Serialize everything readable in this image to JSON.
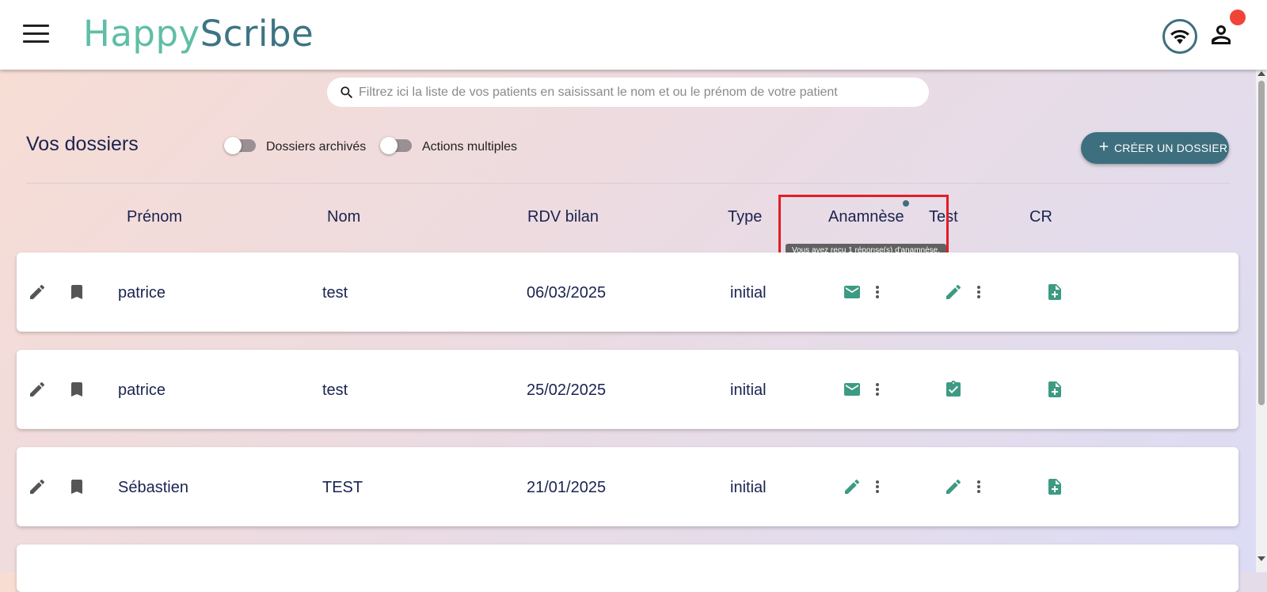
{
  "header": {
    "logo_part1": "Happy",
    "logo_part2": "Scribe",
    "icons": [
      "menu-icon",
      "wifi-icon",
      "user-icon"
    ],
    "notification_color": "#f04438"
  },
  "search": {
    "placeholder": "Filtrez ici la liste de vos patients en saisissant le nom et ou le prénom de votre patient",
    "value": ""
  },
  "toolbar": {
    "title": "Vos dossiers",
    "toggle_archived_label": "Dossiers archivés",
    "toggle_multiple_label": "Actions multiples",
    "create_label": "CRÉER UN DOSSIER"
  },
  "columns": {
    "prenom": "Prénom",
    "nom": "Nom",
    "rdv": "RDV bilan",
    "type": "Type",
    "anamnese": "Anamnèse",
    "test": "Test",
    "cr": "CR"
  },
  "tooltip": "Vous avez reçu 1 réponse(s) d'anamnèse.",
  "rows": [
    {
      "prenom": "patrice",
      "nom": "test",
      "rdv": "06/03/2025",
      "type": "initial",
      "anamnese_icon": "mail-icon",
      "test_icon": "pencil-icon"
    },
    {
      "prenom": "patrice",
      "nom": "test",
      "rdv": "25/02/2025",
      "type": "initial",
      "anamnese_icon": "mail-icon",
      "test_icon": "clipboard-check-icon"
    },
    {
      "prenom": "Sébastien",
      "nom": "TEST",
      "rdv": "21/01/2025",
      "type": "initial",
      "anamnese_icon": "pencil-icon",
      "test_icon": "pencil-icon"
    }
  ],
  "colors": {
    "accent": "#3d6f7e",
    "icon_green": "#3d9a83",
    "text": "#1a2350"
  }
}
